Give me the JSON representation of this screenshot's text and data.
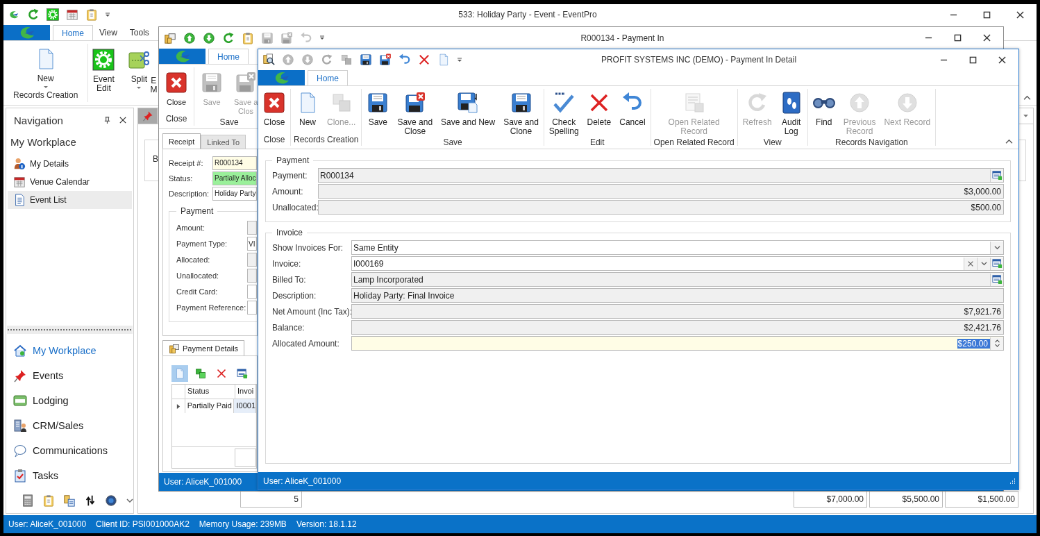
{
  "main_window": {
    "title": "533: Holiday Party - Event - EventPro",
    "ribbon_tabs": [
      {
        "label": "Home",
        "selected": true
      },
      {
        "label": "View",
        "selected": false
      },
      {
        "label": "Tools",
        "selected": false
      }
    ],
    "ribbon_groups": [
      {
        "label": "Records Creation",
        "buttons": [
          {
            "label": "New",
            "dropdown": true
          }
        ]
      },
      {
        "buttons": [
          {
            "label": "Event\nEdit",
            "dropdown": false
          },
          {
            "label": "Split",
            "dropdown": true
          },
          {
            "label": "E\nM",
            "dropdown": false
          }
        ]
      }
    ],
    "navigation": {
      "title": "Navigation",
      "section": "My Workplace",
      "items": [
        {
          "label": "My Details",
          "selected": false
        },
        {
          "label": "Venue Calendar",
          "selected": false
        },
        {
          "label": "Event List",
          "selected": true
        }
      ],
      "modules": [
        {
          "label": "My Workplace",
          "selected": true
        },
        {
          "label": "Events",
          "selected": false
        },
        {
          "label": "Lodging",
          "selected": false
        },
        {
          "label": "CRM/Sales",
          "selected": false
        },
        {
          "label": "Communications",
          "selected": false
        },
        {
          "label": "Tasks",
          "selected": false
        }
      ]
    },
    "document": {
      "label": "B",
      "totals": [
        "5",
        "$7,000.00",
        "$5,500.00",
        "$1,500.00"
      ]
    },
    "status_bar": [
      "User: AliceK_001000",
      "Client ID: PSI001000AK2",
      "Memory Usage: 239MB",
      "Version: 18.1.12"
    ]
  },
  "payment_in_window": {
    "title": "R000134 - Payment In",
    "ribbon_tabs": [
      {
        "label": "Home",
        "selected": true
      }
    ],
    "ribbon_groups": [
      {
        "label": "Close",
        "buttons": [
          {
            "label": "Close",
            "disabled": false
          }
        ]
      },
      {
        "label": "Save",
        "buttons": [
          {
            "label": "Save",
            "disabled": true
          },
          {
            "label": "Save a\nClos",
            "disabled": true
          }
        ]
      }
    ],
    "tabs": [
      {
        "label": "Receipt",
        "selected": true
      },
      {
        "label": "Linked To",
        "selected": false
      }
    ],
    "header_fields": [
      {
        "label": "Receipt #:",
        "value": "R000134",
        "kind": "required"
      },
      {
        "label": "Status:",
        "value": "Partially Alloc",
        "kind": "status"
      },
      {
        "label": "Description:",
        "value": "Holiday Party",
        "kind": "text"
      }
    ],
    "payment_group": {
      "title": "Payment",
      "fields": [
        {
          "label": "Amount:",
          "kind": "readonly"
        },
        {
          "label": "Payment Type:",
          "value": "VI",
          "kind": "text"
        },
        {
          "label": "Allocated:",
          "kind": "readonly"
        },
        {
          "label": "Unallocated:",
          "kind": "readonly"
        },
        {
          "label": "Credit Card:",
          "kind": "text"
        },
        {
          "label": "Payment Reference:",
          "kind": "text"
        }
      ]
    },
    "detail_tabs": [
      {
        "label": "Payment Details",
        "selected": true
      }
    ],
    "grid": {
      "columns": [
        "Status",
        "Invoi"
      ],
      "rows": [
        {
          "cells": [
            "Partially Paid",
            "I0001"
          ],
          "current": true
        }
      ]
    },
    "status_bar": "User: AliceK_001000"
  },
  "payment_in_detail_window": {
    "title": "PROFIT SYSTEMS INC (DEMO) - Payment In Detail",
    "ribbon_tabs": [
      {
        "label": "Home",
        "selected": true
      }
    ],
    "ribbon_groups": [
      {
        "label": "Close",
        "buttons": [
          {
            "label": "Close",
            "disabled": false
          }
        ]
      },
      {
        "label": "Records Creation",
        "buttons": [
          {
            "label": "New",
            "disabled": false
          },
          {
            "label": "Clone...",
            "disabled": true
          }
        ]
      },
      {
        "label": "Save",
        "buttons": [
          {
            "label": "Save",
            "disabled": false
          },
          {
            "label": "Save and\nClose",
            "disabled": false
          },
          {
            "label": "Save and New",
            "disabled": false
          },
          {
            "label": "Save and\nClone",
            "disabled": false
          }
        ]
      },
      {
        "label": "Edit",
        "buttons": [
          {
            "label": "Check\nSpelling",
            "disabled": false
          },
          {
            "label": "Delete",
            "disabled": false
          },
          {
            "label": "Cancel",
            "disabled": false
          }
        ]
      },
      {
        "label": "Open Related Record",
        "buttons": [
          {
            "label": "Open Related\nRecord",
            "disabled": true
          }
        ]
      },
      {
        "label": "View",
        "buttons": [
          {
            "label": "Refresh",
            "disabled": true
          },
          {
            "label": "Audit\nLog",
            "disabled": false
          }
        ]
      },
      {
        "label": "Records Navigation",
        "buttons": [
          {
            "label": "Find",
            "disabled": false
          },
          {
            "label": "Previous\nRecord",
            "disabled": true
          },
          {
            "label": "Next Record",
            "disabled": true
          }
        ]
      }
    ],
    "groups": [
      {
        "title": "Payment",
        "fields": [
          {
            "label": "Payment:",
            "value": "R000134",
            "kind": "lookup_readonly"
          },
          {
            "label": "Amount:",
            "value": "$3,000.00",
            "kind": "amount"
          },
          {
            "label": "Unallocated:",
            "value": "$500.00",
            "kind": "amount"
          }
        ]
      },
      {
        "title": "Invoice",
        "fields": [
          {
            "label": "Show Invoices For:",
            "value": "Same Entity",
            "kind": "dropdown"
          },
          {
            "label": "Invoice:",
            "value": "I000169",
            "kind": "lookup_clear"
          },
          {
            "label": "Billed To:",
            "value": "Lamp Incorporated",
            "kind": "lookup_readonly"
          },
          {
            "label": "Description:",
            "value": "Holiday Party: Final Invoice",
            "kind": "readonly"
          },
          {
            "label": "Net Amount (Inc Tax):",
            "value": "$7,921.76",
            "kind": "amount"
          },
          {
            "label": "Balance:",
            "value": "$2,421.76",
            "kind": "amount"
          },
          {
            "label": "Allocated Amount:",
            "value": "$250.00",
            "kind": "spin"
          }
        ]
      }
    ],
    "status_bar": "User: AliceK_001000"
  }
}
